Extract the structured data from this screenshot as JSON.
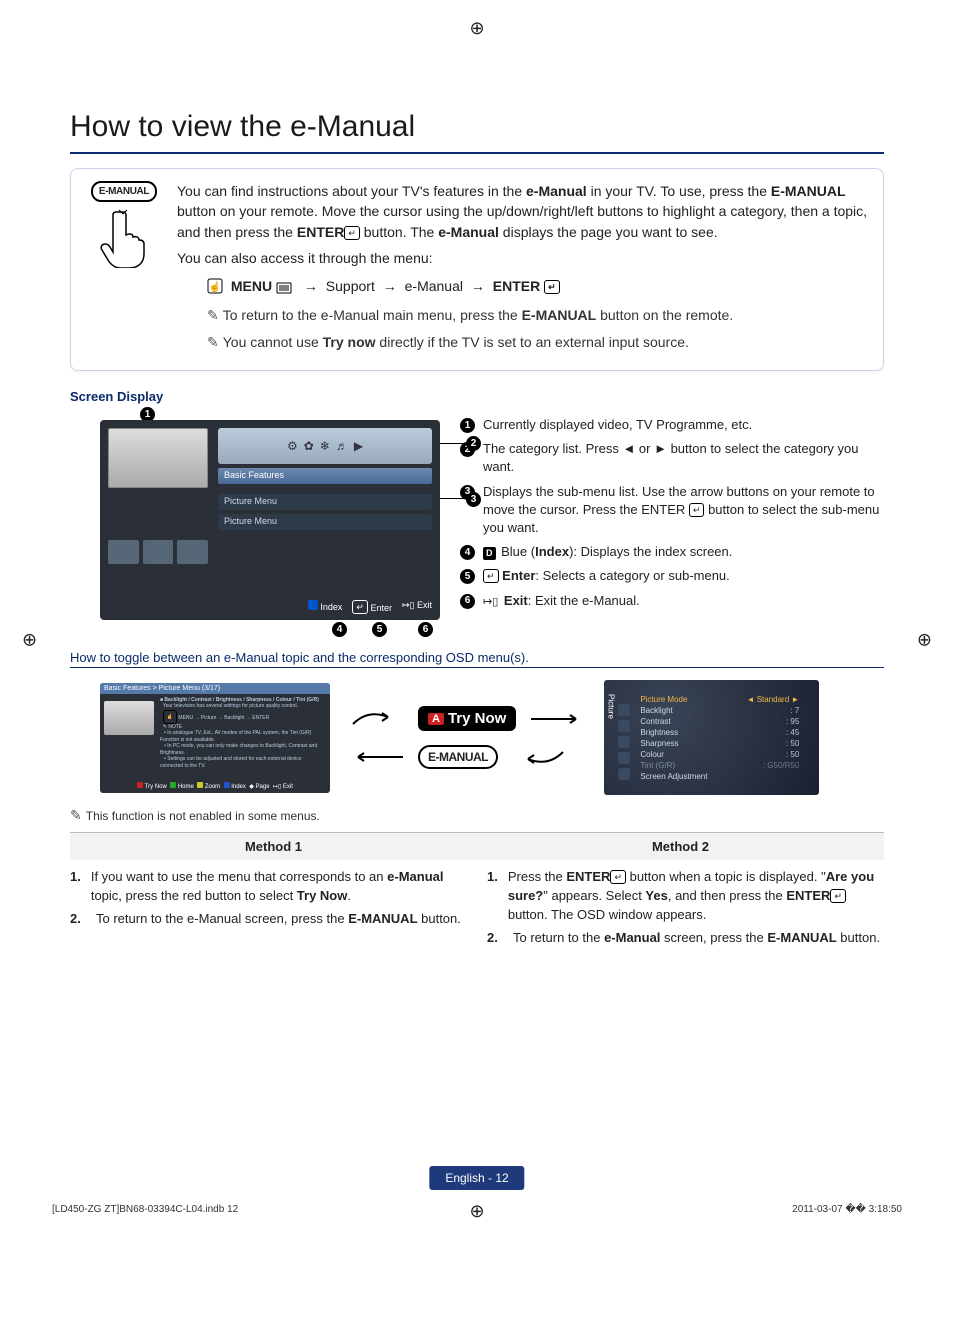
{
  "title": "How to view the e-Manual",
  "emanual_label": "E-MANUAL",
  "intro": {
    "p1_a": "You can find instructions about your TV's features in the ",
    "p1_b": "e-Manual",
    "p1_c": " in your TV. To use, press the ",
    "p1_d": "E-MANUAL",
    "p1_e": " button on your remote. Move the cursor using the up/down/right/left buttons to highlight a category, then a topic, and then press the ",
    "p1_f": "ENTER",
    "p1_g": " button. The ",
    "p1_h": "e-Manual",
    "p1_i": " displays the page you want to see.",
    "p2": "You can also access it through the menu:",
    "menu_path": {
      "menu": "MENU",
      "support": "Support",
      "emanual": "e-Manual",
      "enter": "ENTER"
    },
    "note1_a": "To return to the e-Manual main menu, press the ",
    "note1_b": "E-MANUAL",
    "note1_c": " button on the remote.",
    "note2_a": "You cannot use ",
    "note2_b": "Try now",
    "note2_c": " directly if the TV is set to an external input source."
  },
  "screen_display_title": "Screen Display",
  "mock": {
    "basic": "Basic Features",
    "submenu1": "Picture Menu",
    "submenu2": "Picture Menu",
    "footer_d": "D",
    "footer_index": "Index",
    "footer_enter": "Enter",
    "footer_exit": "Exit"
  },
  "legend": [
    {
      "n": "1",
      "txt": "Currently displayed video, TV Programme, etc."
    },
    {
      "n": "2",
      "txt": "The category list. Press ◄ or ► button to select the category you want."
    },
    {
      "n": "3",
      "txt": "Displays the sub-menu list. Use the arrow buttons on your remote to move the cursor. Press the ENTER",
      "tail": " button to select the sub-menu you want.",
      "has_enter": true
    },
    {
      "n": "4",
      "pre": "D",
      "bold": "Blue",
      "paren": " (Index",
      "txt2": "): Displays the index screen."
    },
    {
      "n": "5",
      "icon": "enter",
      "bold": "Enter",
      "txt2": ": Selects a category or sub-menu."
    },
    {
      "n": "6",
      "icon": "exit",
      "bold": "Exit",
      "txt2": ": Exit the e-Manual."
    }
  ],
  "toggle_heading": "How to toggle between an e-Manual topic and the corresponding OSD menu(s).",
  "mini_head": "Basic Features > Picture Menu (3/17)",
  "mini_line1": "Backlight / Contrast / Brightness / Sharpness / Colour / Tint (G/R)",
  "mini_foot": {
    "try": "Try Now",
    "home": "Home",
    "zoom": "Zoom",
    "index": "Index",
    "page": "Page",
    "exit": "Exit"
  },
  "try_now": "Try Now",
  "a_label": "A",
  "osd": {
    "sidetab": "Picture",
    "rows": [
      {
        "k": "Picture Mode",
        "v": "Standard",
        "sel": true
      },
      {
        "k": "Backlight",
        "v": "7"
      },
      {
        "k": "Contrast",
        "v": "95"
      },
      {
        "k": "Brightness",
        "v": "45"
      },
      {
        "k": "Sharpness",
        "v": "50"
      },
      {
        "k": "Colour",
        "v": "50"
      },
      {
        "k": "Tint (G/R)",
        "v": "G50/R50",
        "dim": true
      },
      {
        "k": "Screen Adjustment",
        "v": ""
      }
    ]
  },
  "note3": "This function is not enabled in some menus.",
  "method1_label": "Method 1",
  "method2_label": "Method 2",
  "method1": [
    {
      "n": "1.",
      "txt_a": "If you want to use the menu that corresponds to an ",
      "b": "e-Manual",
      "txt_b": " topic, press the red button to select ",
      "b2": "Try Now",
      "txt_c": "."
    },
    {
      "n": "2.",
      "txt_a": "To return to the e-Manual screen, press the ",
      "b": "E-MANUAL",
      "txt_b": " button."
    }
  ],
  "method2": [
    {
      "n": "1.",
      "txt_a": "Press the ",
      "b": "ENTER",
      "txt_b": " button when a topic is displayed. \"",
      "b2": "Are you sure?",
      "txt_c": "\" appears. Select ",
      "b3": "Yes",
      "txt_d": ", and then press the ",
      "b4": "ENTER",
      "txt_e": " button. The OSD window appears.",
      "has_enter": true
    },
    {
      "n": "2.",
      "txt_a": "To return to the ",
      "b": "e-Manual",
      "txt_b": " screen, press the ",
      "b2": "E-MANUAL",
      "txt_c": " button."
    }
  ],
  "page_num": "English - 12",
  "footer_file": "[LD450-ZG ZT]BN68-03394C-L04.indb   12",
  "footer_time": "2011-03-07   �� 3:18:50"
}
